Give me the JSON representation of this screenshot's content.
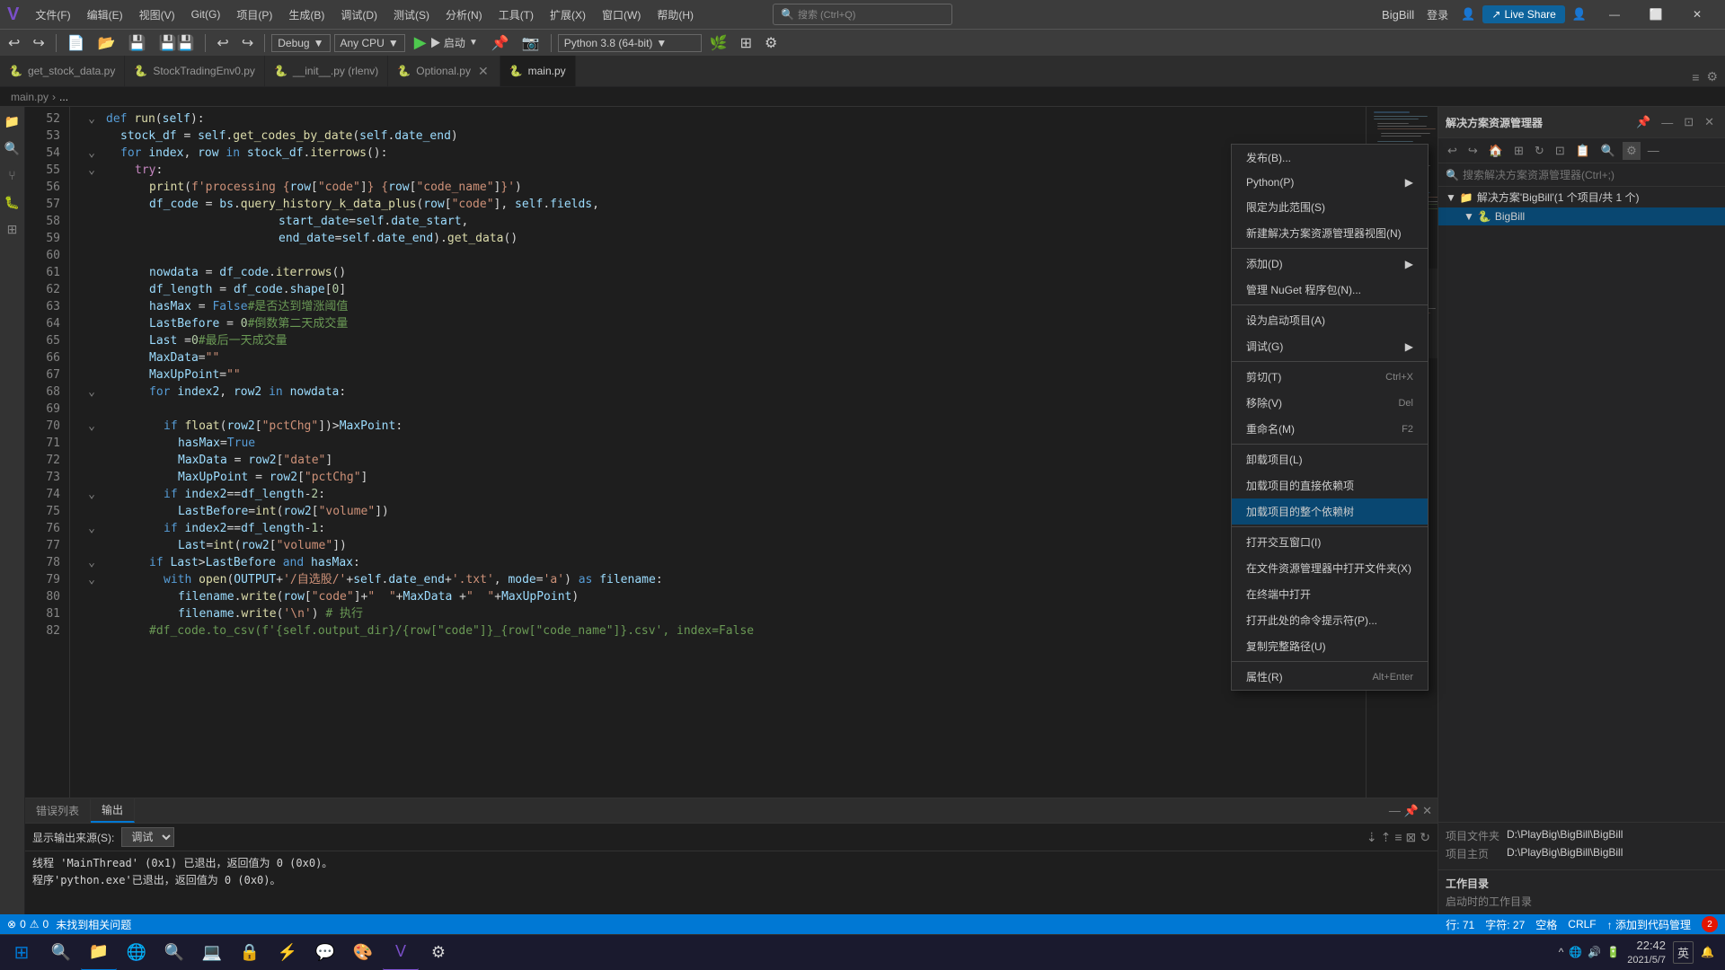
{
  "titleBar": {
    "logo": "V",
    "menus": [
      "文件(F)",
      "编辑(E)",
      "视图(V)",
      "Git(G)",
      "项目(P)",
      "生成(B)",
      "调试(D)",
      "测试(S)",
      "分析(N)",
      "工具(T)",
      "扩展(X)",
      "窗口(W)",
      "帮助(H)"
    ],
    "search": {
      "placeholder": "搜索 (Ctrl+Q)",
      "icon": "🔍"
    },
    "projectName": "BigBill",
    "loginText": "登录",
    "liveShare": "Live Share",
    "winControls": [
      "—",
      "⬜",
      "✕"
    ]
  },
  "toolbar": {
    "debugConfig": "Debug",
    "cpuConfig": "Any CPU",
    "runLabel": "▶ 启动",
    "pythonVersion": "Python 3.8 (64-bit)"
  },
  "tabs": {
    "items": [
      {
        "label": "get_stock_data.py",
        "active": false,
        "closable": false
      },
      {
        "label": "StockTradingEnv0.py",
        "active": false,
        "closable": false
      },
      {
        "label": "__init__.py (rlenv)",
        "active": false,
        "closable": false
      },
      {
        "label": "Optional.py",
        "active": false,
        "closable": true,
        "modified": false
      },
      {
        "label": "main.py",
        "active": true,
        "closable": false
      }
    ]
  },
  "editor": {
    "lines": [
      {
        "num": "",
        "content": "def run(self):",
        "indent": 2
      },
      {
        "num": "",
        "content": "    stock_df = self.get_codes_by_date(self.date_end)",
        "indent": 2
      },
      {
        "num": "",
        "content": "    for index, row in stock_df.iterrows():",
        "indent": 2
      },
      {
        "num": "",
        "content": "        try:",
        "indent": 3
      },
      {
        "num": "",
        "content": "            print(f'processing {row[\"code\"]} {row[\"code_name\"]}')",
        "indent": 3
      },
      {
        "num": "",
        "content": "            df_code = bs.query_history_k_data_plus(row[\"code\"], self.fields,",
        "indent": 3
      },
      {
        "num": "",
        "content": "                                            start_date=self.date_start,",
        "indent": 4
      },
      {
        "num": "",
        "content": "                                            end_date=self.date_end).get_data()",
        "indent": 4
      },
      {
        "num": "",
        "content": "",
        "indent": 0
      },
      {
        "num": "",
        "content": "            nowdata = df_code.iterrows()",
        "indent": 3
      },
      {
        "num": "",
        "content": "            df_length = df_code.shape[0]",
        "indent": 3
      },
      {
        "num": "",
        "content": "            hasMax = False#是否达到增涨阈值",
        "indent": 3,
        "comment": true
      },
      {
        "num": "",
        "content": "            LastBefore = 0#倒数第二天成交量",
        "indent": 3,
        "comment": true
      },
      {
        "num": "",
        "content": "            Last =0#最后一天成交量",
        "indent": 3,
        "comment": true
      },
      {
        "num": "",
        "content": "            MaxData=\"\"",
        "indent": 3
      },
      {
        "num": "",
        "content": "            MaxUpPoint=\"\"",
        "indent": 3
      },
      {
        "num": "",
        "content": "            for index2, row2 in nowdata:",
        "indent": 3
      },
      {
        "num": "",
        "content": "",
        "indent": 0
      },
      {
        "num": "",
        "content": "                if float(row2[\"pctChg\"])>MaxPoint:",
        "indent": 4
      },
      {
        "num": "",
        "content": "                    hasMax=True",
        "indent": 5
      },
      {
        "num": "",
        "content": "                    MaxData = row2[\"date\"]",
        "indent": 5
      },
      {
        "num": "",
        "content": "                    MaxUpPoint = row2[\"pctChg\"]",
        "indent": 5
      },
      {
        "num": "",
        "content": "                if index2==df_length-2:",
        "indent": 4
      },
      {
        "num": "",
        "content": "                    LastBefore=int(row2[\"volume\"])",
        "indent": 5
      },
      {
        "num": "",
        "content": "                if index2==df_length-1:",
        "indent": 4
      },
      {
        "num": "",
        "content": "                    Last=int(row2[\"volume\"])",
        "indent": 5
      },
      {
        "num": "",
        "content": "            if Last>LastBefore and hasMax:",
        "indent": 3
      },
      {
        "num": "",
        "content": "                with open(OUTPUT+'/自选股/'+self.date_end+'.txt', mode='a') as filename:",
        "indent": 4
      },
      {
        "num": "",
        "content": "                    filename.write(row[\"code\"]+\"  \"+MaxData +\"  \"+MaxUpPoint)",
        "indent": 5
      },
      {
        "num": "",
        "content": "                    filename.write('\\n') # 执行",
        "indent": 5
      },
      {
        "num": "",
        "content": "            #df_code.to_csv(f'{self.output_dir}/{row[\"code\"]}_{row[\"code_name\"]}.csv', index=False",
        "indent": 3
      }
    ]
  },
  "statusBar": {
    "errorCount": "0",
    "warningCount": "0",
    "statusText": "未找到相关问题",
    "line": "行: 71",
    "char": "字符: 27",
    "space": "空格",
    "encoding": "CRLF",
    "addToSourceControl": "添加到代码管理"
  },
  "solutionExplorer": {
    "title": "解决方案资源管理器",
    "searchPlaceholder": "搜索解决方案资源管理器(Ctrl+;)",
    "solutionLabel": "解决方案'BigBill'(1 个项目/共 1 个)",
    "projectLabel": "BigBill",
    "contextMenu": {
      "items": [
        {
          "label": "发布(B)...",
          "icon": "📤"
        },
        {
          "label": "Python(P)",
          "icon": "",
          "hasSubmenu": true
        },
        {
          "label": "限定为此范围(S)",
          "icon": ""
        },
        {
          "label": "新建解决方案资源管理器视图(N)",
          "icon": ""
        },
        {
          "label": "添加(D)",
          "icon": "",
          "hasSubmenu": true
        },
        {
          "label": "管理 NuGet 程序包(N)...",
          "icon": "📦"
        },
        {
          "label": "设为启动项目(A)",
          "icon": "⚙"
        },
        {
          "label": "调试(G)",
          "icon": "",
          "hasSubmenu": true
        },
        {
          "label": "剪切(T)",
          "icon": "✂",
          "shortcut": "Ctrl+X"
        },
        {
          "label": "移除(V)",
          "icon": "✕",
          "shortcut": "Del"
        },
        {
          "label": "重命名(M)",
          "icon": "",
          "shortcut": "F2"
        },
        {
          "label": "卸载项目(L)",
          "icon": ""
        },
        {
          "label": "加载项目的直接依赖项",
          "icon": ""
        },
        {
          "label": "加载项目的整个依赖树",
          "icon": "",
          "highlighted": true
        },
        {
          "label": "打开交互窗口(I)",
          "icon": ""
        },
        {
          "label": "在文件资源管理器中打开文件夹(X)",
          "icon": "📁"
        },
        {
          "label": "在终端中打开",
          "icon": ""
        },
        {
          "label": "打开此处的命令提示符(P)...",
          "icon": ""
        },
        {
          "label": "复制完整路径(U)",
          "icon": ""
        },
        {
          "label": "属性(R)",
          "icon": "🔧",
          "shortcut": "Alt+Enter"
        }
      ]
    },
    "properties": {
      "projectFile": {
        "label": "项目文件夹",
        "value": "D:\\PlayBig\\BigBill\\BigBill"
      },
      "projectHome": {
        "label": "项目主页",
        "value": "D:\\PlayBig\\BigBill\\BigBill"
      }
    },
    "workingDir": {
      "label": "工作目录",
      "startupLabel": "启动时的工作目录"
    }
  },
  "outputPanel": {
    "tabs": [
      "错误列表",
      "输出"
    ],
    "activeTab": "输出",
    "sourceLabel": "显示输出来源(S):",
    "sourceValue": "调试",
    "lines": [
      "线程 'MainThread' (0x1) 已退出，返回值为 0 (0x0)。",
      "程序'python.exe'已退出，返回值为 0 (0x0)。"
    ]
  },
  "taskbar": {
    "apps": [
      "⊞",
      "📁",
      "🌐",
      "🔍",
      "💻",
      "🔒",
      "⚡",
      "💬",
      "🎨",
      "💻",
      "⚙"
    ],
    "systray": {
      "time": "22:42",
      "date": "2021/5/7",
      "inputMethod": "英"
    },
    "notification": "2"
  }
}
